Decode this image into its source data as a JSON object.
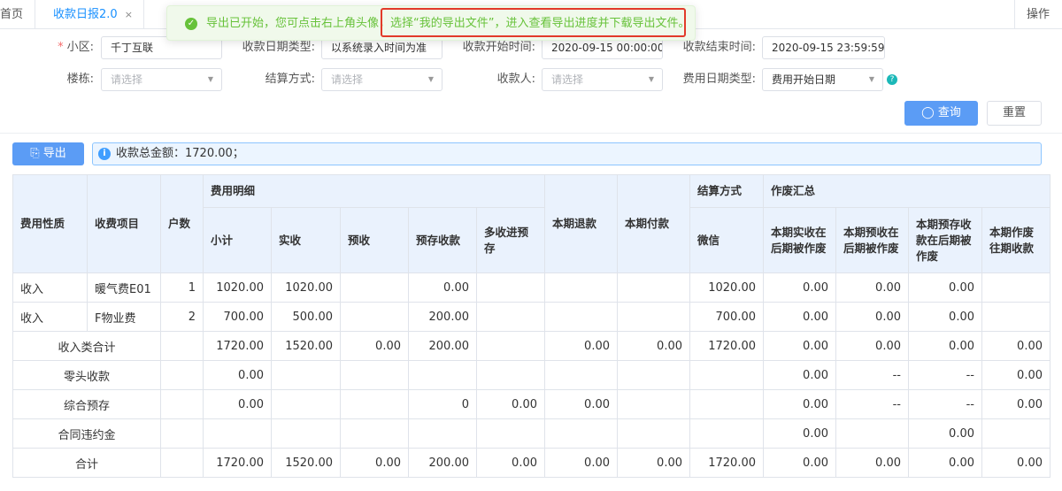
{
  "tabs": {
    "home": "首页",
    "active": "收款日报2.0",
    "active_close": "×",
    "ops": "操作"
  },
  "toast": {
    "icon": "check-circle-icon",
    "message_prefix": "导出已开始，您可点击右上角头像，",
    "message_highlight": "选择“我的导出文件”，进入查看导出进度并下载导出文件。"
  },
  "form": {
    "community": {
      "label": "小区:",
      "value": "千丁互联"
    },
    "date_type": {
      "label": "收款日期类型:",
      "value": "以系统录入时间为准"
    },
    "start_time": {
      "label": "收款开始时间:",
      "value": "2020-09-15 00:00:00"
    },
    "end_time": {
      "label": "收款结束时间:",
      "value": "2020-09-15 23:59:59"
    },
    "building": {
      "label": "楼栋:",
      "placeholder": "请选择"
    },
    "settle_method": {
      "label": "结算方式:",
      "placeholder": "请选择"
    },
    "payee": {
      "label": "收款人:",
      "placeholder": "请选择"
    },
    "fee_date_type": {
      "label": "费用日期类型:",
      "value": "费用开始日期"
    },
    "query_button": "查询",
    "reset_button": "重置"
  },
  "toolbar": {
    "export_button": "导出",
    "summary_text": "收款总金额：1720.00；"
  },
  "table": {
    "head": {
      "fee_nature": "费用性质",
      "fee_item": "收费项目",
      "households": "户数",
      "fee_detail": "费用明细",
      "subtotal": "小计",
      "received": "实收",
      "prepaid": "预收",
      "prestore": "预存收款",
      "overpay": "多收进预存",
      "refund": "本期退款",
      "payment": "本期付款",
      "settle_method": "结算方式",
      "wechat": "微信",
      "void_summary": "作废汇总",
      "void_received": "本期实收在后期被作废",
      "void_prepaid": "本期预收在后期被作废",
      "void_prestore": "本期预存收款在后期被作废",
      "void_past": "本期作废往期收款"
    },
    "rows": [
      [
        "收入",
        "暖气费E01",
        "1",
        "1020.00",
        "1020.00",
        "",
        "0.00",
        "",
        "",
        "",
        "1020.00",
        "0.00",
        "0.00",
        "0.00",
        ""
      ],
      [
        "收入",
        "F物业费",
        "2",
        "700.00",
        "500.00",
        "",
        "200.00",
        "",
        "",
        "",
        "700.00",
        "0.00",
        "0.00",
        "0.00",
        ""
      ]
    ],
    "summary_rows": [
      {
        "label": "收入类合计",
        "cells": [
          "1720.00",
          "1520.00",
          "0.00",
          "200.00",
          "",
          "0.00",
          "0.00",
          "1720.00",
          "0.00",
          "0.00",
          "0.00",
          "0.00"
        ]
      },
      {
        "label": "零头收款",
        "cells": [
          "0.00",
          "",
          "",
          "",
          "",
          "",
          "",
          "",
          "0.00",
          "--",
          "--",
          "0.00"
        ]
      },
      {
        "label": "综合预存",
        "cells": [
          "0.00",
          "",
          "",
          "0",
          "0.00",
          "0.00",
          "",
          "",
          "0.00",
          "--",
          "--",
          "0.00"
        ]
      },
      {
        "label": "合同违约金",
        "cells": [
          "",
          "",
          "",
          "",
          "",
          "",
          "",
          "",
          "0.00",
          "",
          "0.00",
          ""
        ]
      },
      {
        "label": "合计",
        "cells": [
          "1720.00",
          "1520.00",
          "0.00",
          "200.00",
          "0.00",
          "0.00",
          "0.00",
          "1720.00",
          "0.00",
          "0.00",
          "0.00",
          "0.00"
        ]
      }
    ]
  },
  "colors": {
    "primary": "#5b9cf5",
    "success": "#67c23a",
    "highlight_border": "#e23a2a",
    "table_header_bg": "#eaf2fd"
  }
}
